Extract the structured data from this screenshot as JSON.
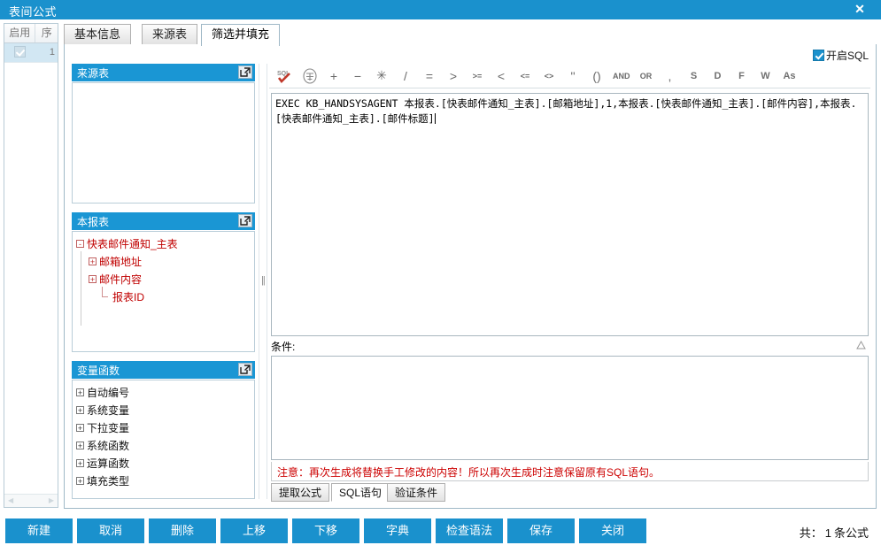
{
  "window": {
    "title": "表间公式",
    "close_label": "✕"
  },
  "left_grid": {
    "columns": [
      "启用",
      "序"
    ],
    "rows": [
      {
        "enabled": true,
        "seq": "1"
      }
    ]
  },
  "tabs": [
    {
      "label": "基本信息",
      "active": false
    },
    {
      "label": "来源表",
      "active": false
    },
    {
      "label": "筛选并填充",
      "active": true
    }
  ],
  "sql_toggle": {
    "label": "开启SQL",
    "checked": true
  },
  "tree_panels": [
    {
      "title": "来源表",
      "expand_icon": "external-link-icon",
      "nodes": []
    },
    {
      "title": "本报表",
      "expand_icon": "external-link-icon",
      "nodes": [
        {
          "label": "快表邮件通知_主表",
          "toggle": "-",
          "indent": 0,
          "color": "red"
        },
        {
          "label": "邮箱地址",
          "toggle": "+",
          "indent": 1,
          "color": "red"
        },
        {
          "label": "邮件内容",
          "toggle": "+",
          "indent": 1,
          "color": "red"
        },
        {
          "label": "报表ID",
          "toggle": "",
          "indent": 2,
          "color": "red"
        }
      ]
    },
    {
      "title": "变量函数",
      "expand_icon": "external-link-icon",
      "nodes": [
        {
          "label": "自动编号",
          "toggle": "+",
          "indent": 0,
          "color": "dark"
        },
        {
          "label": "系统变量",
          "toggle": "+",
          "indent": 0,
          "color": "dark"
        },
        {
          "label": "下拉变量",
          "toggle": "+",
          "indent": 0,
          "color": "dark"
        },
        {
          "label": "系统函数",
          "toggle": "+",
          "indent": 0,
          "color": "dark"
        },
        {
          "label": "运算函数",
          "toggle": "+",
          "indent": 0,
          "color": "dark"
        },
        {
          "label": "填充类型",
          "toggle": "+",
          "indent": 0,
          "color": "dark"
        }
      ]
    }
  ],
  "formula_toolbar": [
    {
      "name": "sql-check-icon",
      "label": "SQL",
      "kind": "icon-sql"
    },
    {
      "name": "chinese-char-icon",
      "label": "字",
      "kind": "icon-circle"
    },
    {
      "name": "plus-operator",
      "label": "+",
      "kind": "sym"
    },
    {
      "name": "minus-operator",
      "label": "−",
      "kind": "sym"
    },
    {
      "name": "multiply-operator",
      "label": "✳",
      "kind": "sym"
    },
    {
      "name": "divide-operator",
      "label": "/",
      "kind": "sym"
    },
    {
      "name": "equals-operator",
      "label": "=",
      "kind": "sym"
    },
    {
      "name": "greater-than-operator",
      "label": ">",
      "kind": "sym"
    },
    {
      "name": "greater-equal-operator",
      "label": ">=",
      "kind": "small"
    },
    {
      "name": "less-than-operator",
      "label": "<",
      "kind": "sym"
    },
    {
      "name": "less-equal-operator",
      "label": "<=",
      "kind": "small"
    },
    {
      "name": "not-equal-operator",
      "label": "<>",
      "kind": "small"
    },
    {
      "name": "quote-operator",
      "label": "''",
      "kind": "sym"
    },
    {
      "name": "parenthesis-operator",
      "label": "()",
      "kind": "sym"
    },
    {
      "name": "and-operator",
      "label": "AND",
      "kind": "small"
    },
    {
      "name": "or-operator",
      "label": "OR",
      "kind": "small"
    },
    {
      "name": "comma-operator",
      "label": ",",
      "kind": "sym"
    },
    {
      "name": "select-keyword",
      "label": "S",
      "kind": "letter"
    },
    {
      "name": "distinct-keyword",
      "label": "D",
      "kind": "letter"
    },
    {
      "name": "from-keyword",
      "label": "F",
      "kind": "letter"
    },
    {
      "name": "where-keyword",
      "label": "W",
      "kind": "letter"
    },
    {
      "name": "as-keyword",
      "label": "As",
      "kind": "letter"
    }
  ],
  "sql_editor": {
    "value": "EXEC KB_HANDSYSAGENT 本报表.[快表邮件通知_主表].[邮箱地址],1,本报表.[快表邮件通知_主表].[邮件内容],本报表.[快表邮件通知_主表].[邮件标题]"
  },
  "condition": {
    "label": "条件:",
    "collapse_icon": "triangle-up-icon",
    "value": ""
  },
  "warning": {
    "text": "注意：再次生成将替换手工修改的内容！所以再次生成时注意保留原有SQL语句。"
  },
  "bottom_tabs": [
    {
      "label": "提取公式",
      "active": false
    },
    {
      "label": "SQL语句",
      "active": true
    },
    {
      "label": "验证条件",
      "active": false
    }
  ],
  "footer": {
    "buttons": [
      {
        "label": "新建",
        "name": "new-button"
      },
      {
        "label": "取消",
        "name": "cancel-button"
      },
      {
        "label": "删除",
        "name": "delete-button"
      },
      {
        "label": "上移",
        "name": "move-up-button"
      },
      {
        "label": "下移",
        "name": "move-down-button"
      },
      {
        "label": "字典",
        "name": "dictionary-button"
      },
      {
        "label": "检查语法",
        "name": "check-syntax-button"
      },
      {
        "label": "保存",
        "name": "save-button"
      },
      {
        "label": "关闭",
        "name": "close-button"
      }
    ],
    "status_prefix": "共：",
    "status_count": "1",
    "status_suffix": "条公式"
  },
  "colors": {
    "accent": "#1a91cd",
    "panel_header": "#1a96d4",
    "warning": "#cc0000",
    "tree_red": "#c00000"
  }
}
